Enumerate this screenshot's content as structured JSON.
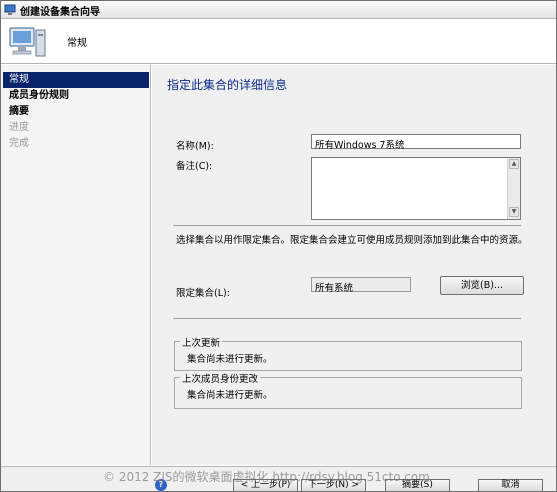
{
  "window": {
    "title": "创建设备集合向导"
  },
  "header": {
    "title": "常规"
  },
  "sidebar": {
    "items": [
      {
        "label": "常规",
        "state": "active"
      },
      {
        "label": "成员身份规则",
        "state": "bold"
      },
      {
        "label": "摘要",
        "state": "bold"
      },
      {
        "label": "进度",
        "state": "disabled"
      },
      {
        "label": "完成",
        "state": "disabled"
      }
    ]
  },
  "main": {
    "section_title": "指定此集合的详细信息",
    "name_label": "名称(M):",
    "name_value": "所有Windows 7系统",
    "comment_label": "备注(C):",
    "comment_value": "",
    "description": "选择集合以用作限定集合。限定集合会建立可使用成员规则添加到此集合中的资源。",
    "limiting_label": "限定集合(L):",
    "limiting_value": "所有系统",
    "browse_label": "浏览(B)...",
    "last_update": {
      "title": "上次更新",
      "text": "集合尚未进行更新。"
    },
    "last_membership": {
      "title": "上次成员身份更改",
      "text": "集合尚未进行更新。"
    }
  },
  "footer": {
    "prev_label": "< 上一步(P)",
    "next_label": "下一步(N) >",
    "summary_label": "摘要(S)",
    "cancel_label": "取消"
  },
  "watermark": "© 2012 ZJS的微软桌面虚拟化 http://rdsy.blog.51cto.com"
}
